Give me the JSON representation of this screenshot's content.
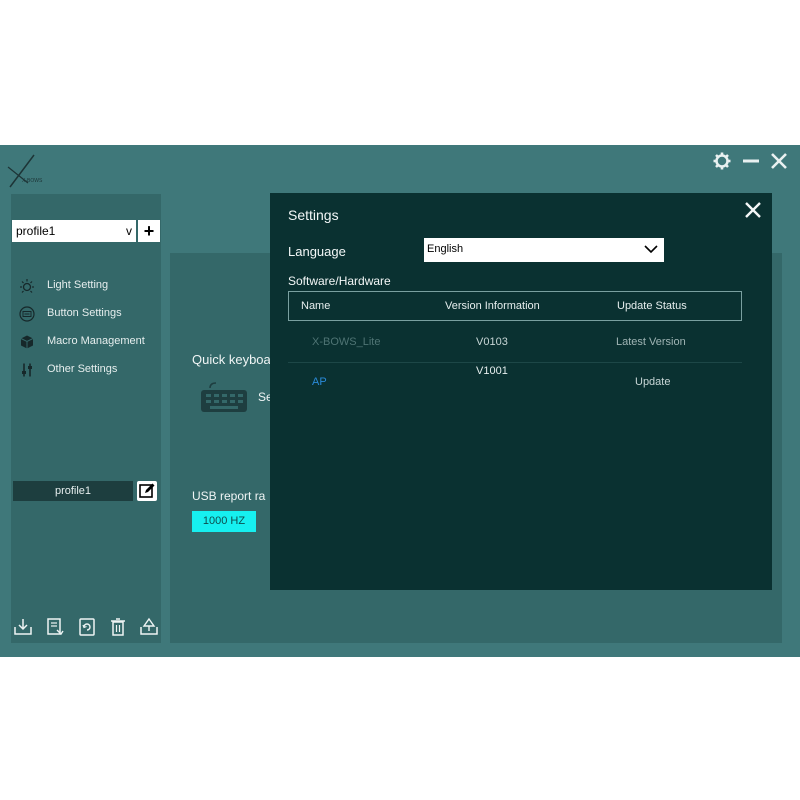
{
  "brand": {
    "logo_text": "X-BOWS"
  },
  "window_controls": {
    "settings_icon": "gear-icon",
    "minimize_icon": "minus-icon",
    "close_icon": "close-icon"
  },
  "sidebar": {
    "profile_select_value": "profile1",
    "profile_select_chevron": "v",
    "add_label": "+",
    "items": [
      {
        "label": "Light Setting",
        "icon": "sun-icon"
      },
      {
        "label": "Button Settings",
        "icon": "keyboard-icon"
      },
      {
        "label": "Macro Management",
        "icon": "cube-icon"
      },
      {
        "label": "Other Settings",
        "icon": "sliders-icon"
      }
    ],
    "profile_name": "profile1",
    "bottom_icons": [
      "import-icon",
      "export-doc-icon",
      "reset-icon",
      "trash-icon",
      "upload-icon"
    ]
  },
  "main": {
    "quick_keyboard_label": "Quick keyboa",
    "quick_keyboard_sub": "Se",
    "usb_report_label": "USB report ra",
    "usb_rate_value": "1000 HZ"
  },
  "settings": {
    "title": "Settings",
    "language_label": "Language",
    "language_value": "English",
    "software_hardware_label": "Software/Hardware",
    "columns": [
      "Name",
      "Version Information",
      "Update Status"
    ],
    "rows": [
      {
        "name": "X-BOWS_Lite",
        "version": "V0103",
        "status": "Latest Version"
      },
      {
        "name": "AP",
        "version": "V1001",
        "status": "Update"
      }
    ]
  },
  "colors": {
    "app_bg": "#3f787a",
    "sidebar_bg": "#346869",
    "modal_bg": "#0a3131",
    "accent_cyan": "#16f0f0",
    "link_blue": "#2a8ad8"
  }
}
